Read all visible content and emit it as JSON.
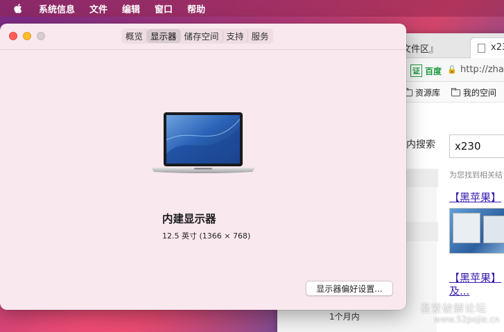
{
  "menubar": {
    "apple_icon": "apple-logo-icon",
    "items": [
      "系统信息",
      "文件",
      "编辑",
      "窗口",
      "帮助"
    ]
  },
  "browser": {
    "tab_left": "文件区』",
    "tab_active": "x23",
    "cert_badge": "证",
    "cert_text": "百度",
    "url": "http://zha",
    "bookmarks": [
      "资源库",
      "我的空间"
    ],
    "search_label": "内搜索",
    "search_value": "x230",
    "found_text": "为您找到相关结",
    "results": [
      "【黑苹果】",
      "【黑苹果】",
      "及..."
    ],
    "time_filter": "1个月内",
    "watermark": "吾爱破解论坛",
    "watermark_url": "www.52pojie.cn"
  },
  "sysinfo": {
    "tabs": [
      "概览",
      "显示器",
      "储存空间",
      "支持",
      "服务"
    ],
    "active_tab": "显示器",
    "display_name": "内建显示器",
    "display_spec": "12.5 英寸 (1366 × 768)",
    "pref_button": "显示器偏好设置..."
  },
  "colors": {
    "window_bg": "#f9e8ee",
    "close": "#fe5f57",
    "minimize": "#febc2e",
    "link": "#3a1ab0"
  }
}
